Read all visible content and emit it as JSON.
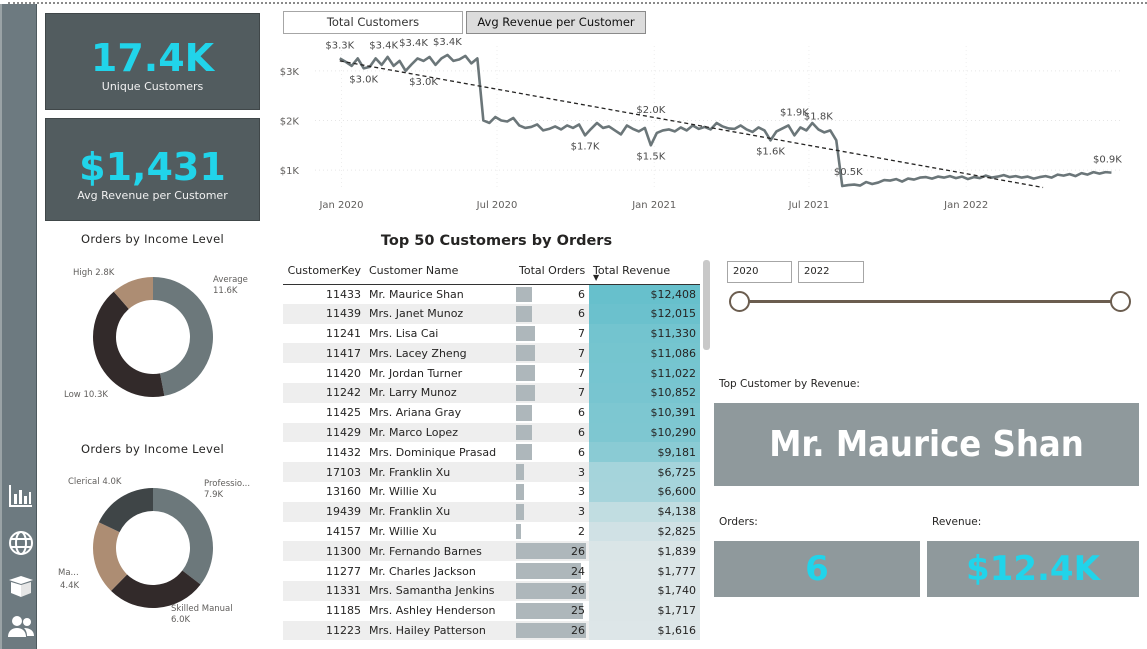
{
  "nav": {
    "icons": [
      "bar-chart-icon",
      "globe-icon",
      "box-icon",
      "people-icon"
    ]
  },
  "kpis": {
    "unique_customers": {
      "value": "17.4K",
      "label": "Unique Customers"
    },
    "avg_revenue": {
      "value": "$1,431",
      "label": "Avg Revenue per Customer"
    }
  },
  "donut_income": {
    "title": "Orders by Income Level",
    "slices": [
      {
        "name": "Average",
        "value": "11.6K",
        "num": 11.6,
        "color": "#6c787b"
      },
      {
        "name": "Low",
        "value": "10.3K",
        "num": 10.3,
        "color": "#322a2a"
      },
      {
        "name": "High",
        "value": "2.8K",
        "num": 2.8,
        "color": "#ad8d73"
      }
    ],
    "labels": {
      "average": "Average",
      "average_val": "11.6K",
      "low": "Low 10.3K",
      "high": "High 2.8K"
    }
  },
  "donut_occupation": {
    "title": "Orders by Income Level",
    "slices": [
      {
        "name": "Professio...",
        "value": "7.9K",
        "num": 7.9,
        "color": "#6c787b"
      },
      {
        "name": "Skilled Manual",
        "value": "6.0K",
        "num": 6.0,
        "color": "#322a2a"
      },
      {
        "name": "Ma...",
        "value": "4.4K",
        "num": 4.4,
        "color": "#ad8d73"
      },
      {
        "name": "Clerical",
        "value": "4.0K",
        "num": 4.0,
        "color": "#3f4547"
      }
    ],
    "labels": {
      "prof": "Professio...",
      "prof_val": "7.9K",
      "skilled": "Skilled Manual",
      "skilled_val": "6.0K",
      "ma": "Ma...",
      "ma_val": "4.4K",
      "clerical": "Clerical 4.0K"
    }
  },
  "tabs": {
    "total_customers": "Total Customers",
    "avg_revenue": "Avg Revenue per Customer"
  },
  "chart_data": {
    "type": "line",
    "y_ticks": [
      "$1K",
      "$2K",
      "$3K"
    ],
    "x_ticks": [
      "Jan 2020",
      "Jul 2020",
      "Jan 2021",
      "Jul 2021",
      "Jan 2022"
    ],
    "ylim": [
      600,
      3500
    ],
    "x_range": [
      "2019-12",
      "2022-06"
    ],
    "series": [
      {
        "values": [
          [
            "2019-12-30",
            3250
          ],
          [
            "2020-01-06",
            3180
          ],
          [
            "2020-01-13",
            3100
          ],
          [
            "2020-01-20",
            3250
          ],
          [
            "2020-01-27",
            3050
          ],
          [
            "2020-02-03",
            3080
          ],
          [
            "2020-02-10",
            3250
          ],
          [
            "2020-02-17",
            3120
          ],
          [
            "2020-02-24",
            3280
          ],
          [
            "2020-03-02",
            3100
          ],
          [
            "2020-03-09",
            3200
          ],
          [
            "2020-03-16",
            3000
          ],
          [
            "2020-03-23",
            3130
          ],
          [
            "2020-03-30",
            3250
          ],
          [
            "2020-04-06",
            3200
          ],
          [
            "2020-04-13",
            3280
          ],
          [
            "2020-04-20",
            3120
          ],
          [
            "2020-04-27",
            3250
          ],
          [
            "2020-05-04",
            3320
          ],
          [
            "2020-05-11",
            3200
          ],
          [
            "2020-05-18",
            3230
          ],
          [
            "2020-05-25",
            3300
          ],
          [
            "2020-06-01",
            3150
          ],
          [
            "2020-06-08",
            3250
          ],
          [
            "2020-06-15",
            2000
          ],
          [
            "2020-06-22",
            1950
          ],
          [
            "2020-06-29",
            2070
          ],
          [
            "2020-07-06",
            2000
          ],
          [
            "2020-07-13",
            1980
          ],
          [
            "2020-07-20",
            2050
          ],
          [
            "2020-07-27",
            1900
          ],
          [
            "2020-08-03",
            1850
          ],
          [
            "2020-08-10",
            1870
          ],
          [
            "2020-08-17",
            1920
          ],
          [
            "2020-08-24",
            1800
          ],
          [
            "2020-08-31",
            1830
          ],
          [
            "2020-09-07",
            1880
          ],
          [
            "2020-09-14",
            1820
          ],
          [
            "2020-09-21",
            1900
          ],
          [
            "2020-09-28",
            1850
          ],
          [
            "2020-10-05",
            1920
          ],
          [
            "2020-10-12",
            1700
          ],
          [
            "2020-10-19",
            1830
          ],
          [
            "2020-10-26",
            1950
          ],
          [
            "2020-11-02",
            1850
          ],
          [
            "2020-11-09",
            1880
          ],
          [
            "2020-11-16",
            1800
          ],
          [
            "2020-11-23",
            1720
          ],
          [
            "2020-11-30",
            1900
          ],
          [
            "2020-12-07",
            1830
          ],
          [
            "2020-12-14",
            1780
          ],
          [
            "2020-12-21",
            1850
          ],
          [
            "2020-12-28",
            1500
          ],
          [
            "2021-01-04",
            1750
          ],
          [
            "2021-01-11",
            1800
          ],
          [
            "2021-01-18",
            1820
          ],
          [
            "2021-01-25",
            1780
          ],
          [
            "2021-02-01",
            1860
          ],
          [
            "2021-02-08",
            1800
          ],
          [
            "2021-02-15",
            1900
          ],
          [
            "2021-02-22",
            1830
          ],
          [
            "2021-03-01",
            1870
          ],
          [
            "2021-03-08",
            1820
          ],
          [
            "2021-03-15",
            1950
          ],
          [
            "2021-03-22",
            1880
          ],
          [
            "2021-03-29",
            1840
          ],
          [
            "2021-04-05",
            1830
          ],
          [
            "2021-04-12",
            1900
          ],
          [
            "2021-04-19",
            1820
          ],
          [
            "2021-04-26",
            1770
          ],
          [
            "2021-05-03",
            1860
          ],
          [
            "2021-05-10",
            1800
          ],
          [
            "2021-05-17",
            1600
          ],
          [
            "2021-05-24",
            1780
          ],
          [
            "2021-05-31",
            1840
          ],
          [
            "2021-06-07",
            1900
          ],
          [
            "2021-06-14",
            1700
          ],
          [
            "2021-06-21",
            1860
          ],
          [
            "2021-06-28",
            1800
          ],
          [
            "2021-07-05",
            1950
          ],
          [
            "2021-07-12",
            1820
          ],
          [
            "2021-07-19",
            1760
          ],
          [
            "2021-07-26",
            1800
          ],
          [
            "2021-08-02",
            1600
          ],
          [
            "2021-08-09",
            680
          ],
          [
            "2021-08-16",
            700
          ],
          [
            "2021-08-23",
            710
          ],
          [
            "2021-08-30",
            690
          ],
          [
            "2021-09-06",
            760
          ],
          [
            "2021-09-13",
            720
          ],
          [
            "2021-09-20",
            750
          ],
          [
            "2021-09-27",
            800
          ],
          [
            "2021-10-04",
            790
          ],
          [
            "2021-10-11",
            820
          ],
          [
            "2021-10-18",
            770
          ],
          [
            "2021-10-25",
            830
          ],
          [
            "2021-11-01",
            810
          ],
          [
            "2021-11-08",
            850
          ],
          [
            "2021-11-15",
            860
          ],
          [
            "2021-11-22",
            830
          ],
          [
            "2021-11-29",
            870
          ],
          [
            "2021-12-06",
            850
          ],
          [
            "2021-12-13",
            880
          ],
          [
            "2021-12-20",
            840
          ],
          [
            "2021-12-27",
            870
          ],
          [
            "2022-01-03",
            820
          ],
          [
            "2022-01-10",
            860
          ],
          [
            "2022-01-17",
            840
          ],
          [
            "2022-01-24",
            890
          ],
          [
            "2022-01-31",
            850
          ],
          [
            "2022-02-07",
            870
          ],
          [
            "2022-02-14",
            900
          ],
          [
            "2022-02-21",
            860
          ],
          [
            "2022-02-28",
            880
          ],
          [
            "2022-03-07",
            850
          ],
          [
            "2022-03-14",
            870
          ],
          [
            "2022-03-21",
            830
          ],
          [
            "2022-03-28",
            860
          ],
          [
            "2022-04-04",
            880
          ],
          [
            "2022-04-11",
            850
          ],
          [
            "2022-04-18",
            910
          ],
          [
            "2022-04-25",
            890
          ],
          [
            "2022-05-02",
            920
          ],
          [
            "2022-05-09",
            880
          ],
          [
            "2022-05-16",
            940
          ],
          [
            "2022-05-23",
            910
          ],
          [
            "2022-05-30",
            960
          ],
          [
            "2022-06-06",
            930
          ],
          [
            "2022-06-13",
            960
          ],
          [
            "2022-06-20",
            950
          ]
        ]
      }
    ],
    "trend": [
      [
        "2019-12-30",
        3200
      ],
      [
        "2022-04-01",
        650
      ]
    ],
    "data_labels": [
      {
        "x": "2019-12-30",
        "y": 3250,
        "text": "$3.3K"
      },
      {
        "x": "2020-01-27",
        "y": 3050,
        "text": "$3.0K"
      },
      {
        "x": "2020-02-10",
        "y": 3250,
        "text": "$3.4K"
      },
      {
        "x": "2020-03-16",
        "y": 3300,
        "text": "$3.4K"
      },
      {
        "x": "2020-04-06",
        "y": 3000,
        "text": "$3.0K"
      },
      {
        "x": "2020-05-04",
        "y": 3320,
        "text": "$3.4K"
      },
      {
        "x": "2020-10-12",
        "y": 1700,
        "text": "$1.7K"
      },
      {
        "x": "2020-12-28",
        "y": 1500,
        "text": "$1.5K"
      },
      {
        "x": "2020-12-28",
        "y": 1950,
        "text": "$2.0K"
      },
      {
        "x": "2021-05-17",
        "y": 1600,
        "text": "$1.6K"
      },
      {
        "x": "2021-06-14",
        "y": 1900,
        "text": "$1.9K"
      },
      {
        "x": "2021-07-12",
        "y": 1820,
        "text": "$1.8K"
      },
      {
        "x": "2021-08-16",
        "y": 700,
        "text": "$0.5K"
      },
      {
        "x": "2022-06-20",
        "y": 950,
        "text": "$0.9K"
      }
    ],
    "grid": true
  },
  "table": {
    "title": "Top 50 Customers by Orders",
    "columns": [
      "CustomerKey",
      "Customer Name",
      "Total Orders",
      "Total Revenue"
    ],
    "max_orders": 26,
    "rows": [
      {
        "key": "11433",
        "name": "Mr. Maurice Shan",
        "orders": 6,
        "revenue": "$12,408",
        "rev": 12408
      },
      {
        "key": "11439",
        "name": "Mrs. Janet Munoz",
        "orders": 6,
        "revenue": "$12,015",
        "rev": 12015
      },
      {
        "key": "11241",
        "name": "Mrs. Lisa Cai",
        "orders": 7,
        "revenue": "$11,330",
        "rev": 11330
      },
      {
        "key": "11417",
        "name": "Mrs. Lacey Zheng",
        "orders": 7,
        "revenue": "$11,086",
        "rev": 11086
      },
      {
        "key": "11420",
        "name": "Mr. Jordan Turner",
        "orders": 7,
        "revenue": "$11,022",
        "rev": 11022
      },
      {
        "key": "11242",
        "name": "Mr. Larry Munoz",
        "orders": 7,
        "revenue": "$10,852",
        "rev": 10852
      },
      {
        "key": "11425",
        "name": "Mrs. Ariana Gray",
        "orders": 6,
        "revenue": "$10,391",
        "rev": 10391
      },
      {
        "key": "11429",
        "name": "Mr. Marco Lopez",
        "orders": 6,
        "revenue": "$10,290",
        "rev": 10290
      },
      {
        "key": "11432",
        "name": "Mrs. Dominique Prasad",
        "orders": 6,
        "revenue": "$9,181",
        "rev": 9181
      },
      {
        "key": "17103",
        "name": "Mr. Franklin Xu",
        "orders": 3,
        "revenue": "$6,725",
        "rev": 6725
      },
      {
        "key": "13160",
        "name": "Mr. Willie Xu",
        "orders": 3,
        "revenue": "$6,600",
        "rev": 6600
      },
      {
        "key": "19439",
        "name": "Mr. Franklin Xu",
        "orders": 3,
        "revenue": "$4,138",
        "rev": 4138
      },
      {
        "key": "14157",
        "name": "Mr. Willie Xu",
        "orders": 2,
        "revenue": "$2,825",
        "rev": 2825
      },
      {
        "key": "11300",
        "name": "Mr. Fernando Barnes",
        "orders": 26,
        "revenue": "$1,839",
        "rev": 1839
      },
      {
        "key": "11277",
        "name": "Mr. Charles Jackson",
        "orders": 24,
        "revenue": "$1,777",
        "rev": 1777
      },
      {
        "key": "11331",
        "name": "Mrs. Samantha Jenkins",
        "orders": 26,
        "revenue": "$1,740",
        "rev": 1740
      },
      {
        "key": "11185",
        "name": "Mrs. Ashley Henderson",
        "orders": 25,
        "revenue": "$1,717",
        "rev": 1717
      },
      {
        "key": "11223",
        "name": "Mrs. Hailey Patterson",
        "orders": 26,
        "revenue": "$1,616",
        "rev": 1616
      }
    ]
  },
  "filters": {
    "year_from": "2020",
    "year_to": "2022"
  },
  "top_customer": {
    "label": "Top Customer by Revenue:",
    "name": "Mr. Maurice Shan",
    "orders_label": "Orders:",
    "orders": "6",
    "revenue_label": "Revenue:",
    "revenue": "$12.4K"
  },
  "colors": {
    "accent": "#21d4ea",
    "card": "#525c5f",
    "card_light": "#8f999c",
    "line": "#6b7679",
    "slider": "#6b5d4f"
  }
}
